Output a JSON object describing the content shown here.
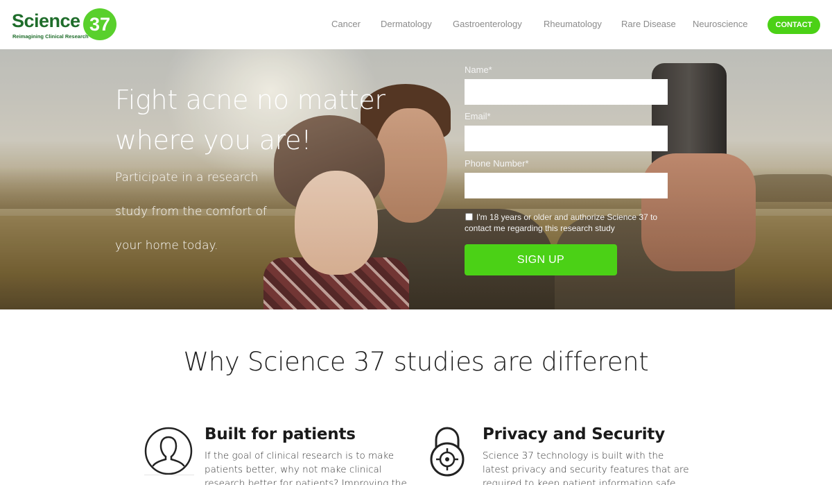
{
  "brand": {
    "name": "Science",
    "number": "37",
    "tagline": "Reimagining Clinical Research",
    "colors": {
      "green_dark": "#1f6d2b",
      "green_accent": "#4bd116"
    }
  },
  "nav": {
    "items": [
      "Cancer",
      "Dermatology",
      "Gastroenterology",
      "Rheumatology",
      "Rare Disease",
      "Neuroscience"
    ],
    "contact_label": "CONTACT"
  },
  "hero": {
    "title": "Fight acne no matter where you are!",
    "subtitle": "Participate in a research study from the comfort of your home today."
  },
  "form": {
    "name_label": "Name*",
    "email_label": "Email*",
    "phone_label": "Phone Number*",
    "name_value": "",
    "email_value": "",
    "phone_value": "",
    "consent_text": "I'm 18 years or older and authorize Science 37 to contact me regarding this research study",
    "consent_checked": false,
    "submit_label": "SIGN UP"
  },
  "why": {
    "title": "Why Science 37 studies are different",
    "features": [
      {
        "icon": "user-icon",
        "title": "Built for patients",
        "text": "If the goal of clinical research is to make patients better, why not make clinical research better for patients? Improving the clinical"
      },
      {
        "icon": "padlock-icon",
        "title": "Privacy and Security",
        "text": "Science 37 technology is built with the latest privacy and security features that are required to keep patient information safe. We follow all"
      }
    ]
  }
}
